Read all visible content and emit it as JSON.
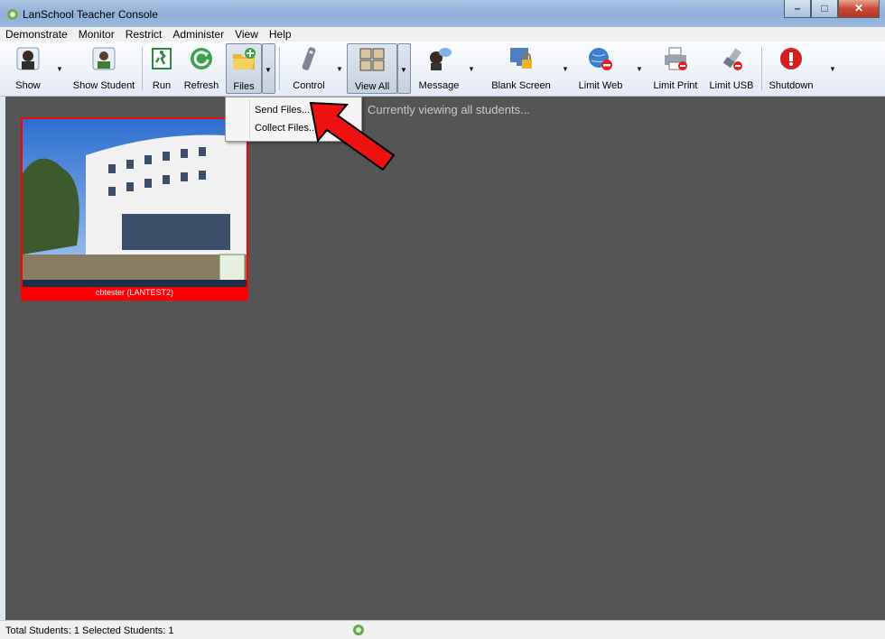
{
  "window": {
    "title": "LanSchool Teacher Console",
    "minimize_icon": "minimize-icon",
    "maximize_icon": "maximize-icon",
    "close_icon": "close-icon"
  },
  "menubar": {
    "items": [
      "Demonstrate",
      "Monitor",
      "Restrict",
      "Administer",
      "View",
      "Help"
    ]
  },
  "toolbar": {
    "show": "Show",
    "show_student": "Show Student",
    "run": "Run",
    "refresh": "Refresh",
    "files": "Files",
    "control": "Control",
    "view_all": "View All",
    "message": "Message",
    "blank_screen": "Blank Screen",
    "limit_web": "Limit Web",
    "limit_print": "Limit Print",
    "limit_usb": "Limit USB",
    "shutdown": "Shutdown"
  },
  "files_menu": {
    "items": [
      "Send Files...",
      "Collect Files..."
    ]
  },
  "main": {
    "viewing_text": "Currently viewing all students...",
    "student": {
      "label": "cbtester (LANTEST2)",
      "border_color": "#ff0000"
    }
  },
  "statusbar": {
    "text": "Total Students: 1  Selected Students: 1"
  }
}
